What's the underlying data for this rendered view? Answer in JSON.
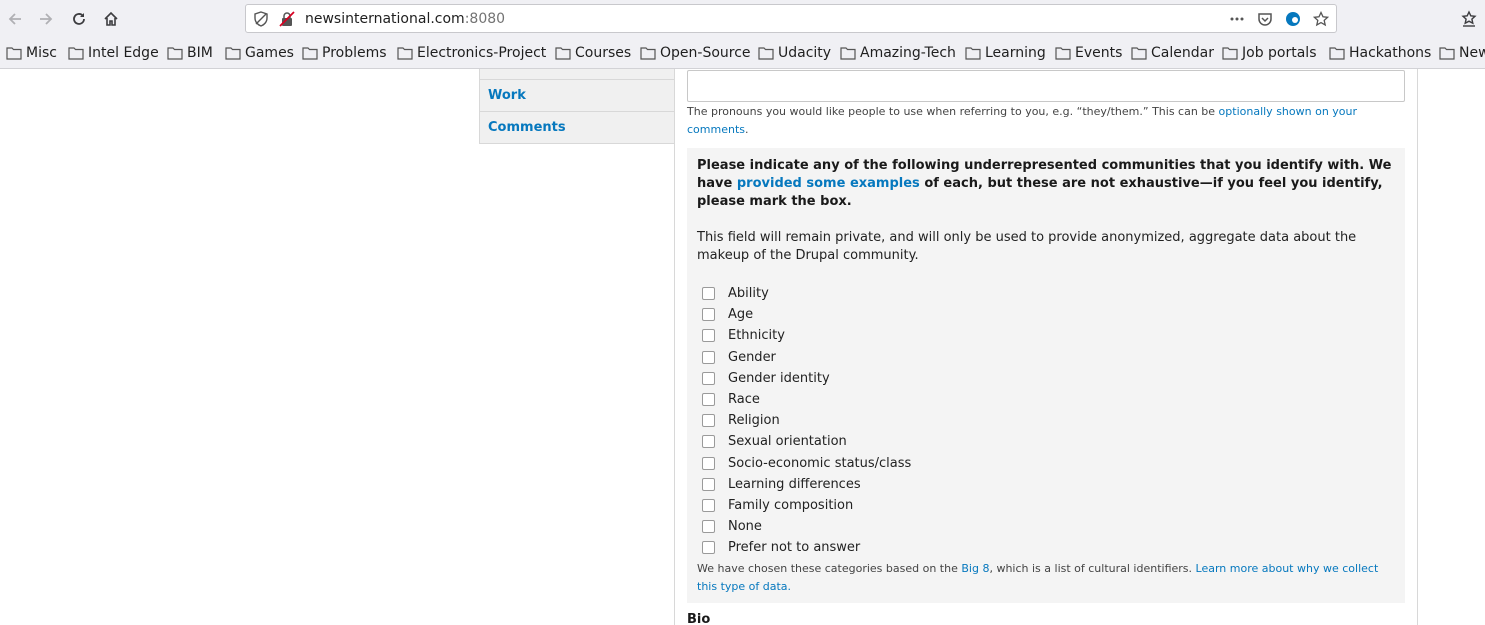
{
  "browser": {
    "url_host": "newsinternational.com",
    "url_port": ":8080",
    "bookmarks": [
      "Misc",
      "Intel Edge",
      "BIM",
      "Games",
      "Problems",
      "Electronics-Project",
      "Courses",
      "Open-Source",
      "Udacity",
      "Amazing-Tech",
      "Learning",
      "Events",
      "Calendar",
      "Job portals",
      "Hackathons",
      "New"
    ]
  },
  "sidenav": {
    "items": [
      "Work",
      "Comments"
    ]
  },
  "pronouns": {
    "help_prefix": "The pronouns you would like people to use when referring to you, e.g. “they/them.” This can be ",
    "help_link": "optionally shown on your comments",
    "help_suffix": "."
  },
  "communities": {
    "title_prefix": "Please indicate any of the following underrepresented communities that you identify with. We have ",
    "title_link": "provided some examples",
    "title_suffix": " of each, but these are not exhaustive—if you feel you identify, please mark the box.",
    "description": "This field will remain private, and will only be used to provide anonymized, aggregate data about the makeup of the Drupal community.",
    "options": [
      "Ability",
      "Age",
      "Ethnicity",
      "Gender",
      "Gender identity",
      "Race",
      "Religion",
      "Sexual orientation",
      "Socio-economic status/class",
      "Learning differences",
      "Family composition",
      "None",
      "Prefer not to answer"
    ],
    "note_prefix": "We have chosen these categories based on the ",
    "note_link1": "Big 8",
    "note_middle": ", which is a list of cultural identifiers. ",
    "note_link2": "Learn more about why we collect this type of data."
  },
  "bio": {
    "label": "Bio"
  }
}
